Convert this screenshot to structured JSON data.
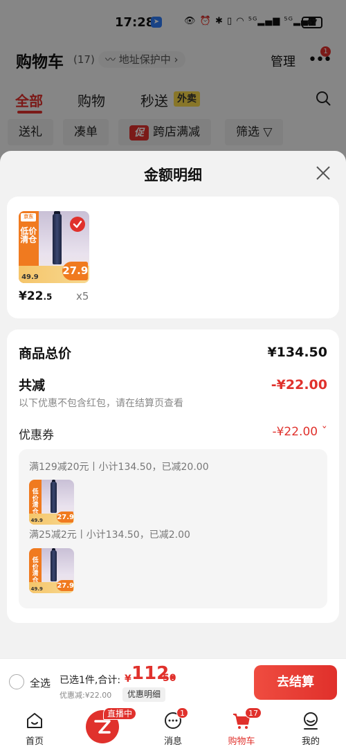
{
  "status_bar": {
    "time": "17:28",
    "icons": "👁 ⏰ ✱ ▯ ◠ ⁵ᴳ▂▄▆ ⁵ᴳ▂▄▆",
    "battery": "67"
  },
  "header": {
    "title": "购物车",
    "count": "(17)",
    "address_guard": "〰 地址保护中 ›",
    "manage": "管理",
    "more_badge": "1"
  },
  "tabs": [
    {
      "label": "全部",
      "active": true
    },
    {
      "label": "购物",
      "active": false
    },
    {
      "label": "秒送",
      "active": false,
      "tag": "外卖"
    }
  ],
  "filters": [
    {
      "label": "送礼"
    },
    {
      "label": "凑单"
    },
    {
      "label": "跨店满减",
      "badge": "促"
    },
    {
      "label": "筛选 ▽"
    }
  ],
  "sheet": {
    "title": "金额明细",
    "item": {
      "price_main": "¥22",
      "price_dec": ".5",
      "qty": "x5"
    },
    "thumb": {
      "ribbon_tag": "京东",
      "ribbon_text": "低价清仓",
      "old_price": "49.9",
      "new_price": "27.9"
    },
    "goods_total_label": "商品总价",
    "goods_total_value": "¥134.50",
    "reduce_label": "共减",
    "reduce_value": "-¥22.00",
    "hint": "以下优惠不包含红包，请在结算页查看",
    "coupon_label": "优惠券",
    "coupon_value": "-¥22.00 ˇ",
    "promos": [
      {
        "text": "满129减20元丨小计134.50，已减20.00"
      },
      {
        "text": "满25减2元丨小计134.50，已减2.00"
      }
    ]
  },
  "checkout": {
    "select_all": "全选",
    "summary": "已选1件,合计:",
    "total_symbol": "¥",
    "total_int": "112.",
    "total_dec": "50",
    "discount": "优惠减:¥22.00",
    "detail_button": "优惠明细",
    "pay_button": "去结算"
  },
  "nav": {
    "home": "首页",
    "live_tag": "直播中",
    "messages": "消息",
    "messages_badge": "1",
    "cart": "购物车",
    "cart_badge": "17",
    "mine": "我的"
  },
  "colors": {
    "accent": "#e0312c",
    "overlay": "rgba(0,0,0,0.45)",
    "promo_orange": "#f07a1f"
  }
}
